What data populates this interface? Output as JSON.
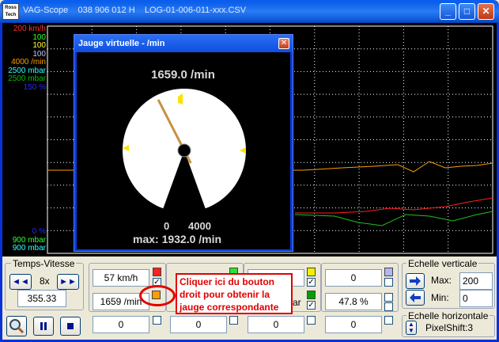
{
  "window": {
    "app_name": "VAG-Scope",
    "title_text": "VAG-Scope    038 906 012 H    LOG-01-006-011-xxx.CSV",
    "logo_text": "Ross Tech"
  },
  "chart": {
    "labels": [
      {
        "text": "200 km/h",
        "color": "#ff3030"
      },
      {
        "text": "100",
        "color": "#30ff30"
      },
      {
        "text": "100",
        "color": "#ffff30"
      },
      {
        "text": "100",
        "color": "#c0c0ff"
      },
      {
        "text": "4000 /min",
        "color": "#ff9c00"
      },
      {
        "text": "2500 mbar",
        "color": "#30ffff"
      },
      {
        "text": "2500 mbar",
        "color": "#00c000"
      },
      {
        "text": "150 %",
        "color": "#2a2aff"
      }
    ],
    "bottom_labels": [
      {
        "text": "0 %",
        "color": "#2a2aff"
      },
      {
        "text": "900 mbar",
        "color": "#30ff30"
      },
      {
        "text": "900 mbar",
        "color": "#30ffff"
      }
    ],
    "series_colors": {
      "speed": "#ff2020",
      "rpm": "#ff9c00",
      "pressure": "#20c020"
    }
  },
  "gauge": {
    "title": "Jauge virtuelle - /min",
    "current_value": "1659.0 /min",
    "range_min": "0",
    "range_max": "4000",
    "max_value": "max: 1932.0 /min",
    "needle_fraction": 0.415
  },
  "panel": {
    "temps_vitesse": {
      "title": "Temps-Vitesse",
      "speed": "8x",
      "time": "355.33",
      "rew": "◄◄",
      "fwd": "►►"
    },
    "fields": {
      "f1": "57 km/h",
      "f2": "1659 /min",
      "f3": "0",
      "f4": "0",
      "f5": "0",
      "f6": "0",
      "f7": "0",
      "f8": "ar",
      "f9": "0",
      "f10": "47.8 %",
      "f11": "0"
    },
    "check_mark": "✓",
    "echelle_verticale": {
      "title": "Echelle verticale",
      "max_label": "Max:",
      "max_value": "200",
      "min_label": "Min:",
      "min_value": "0"
    },
    "echelle_horizontale": {
      "title": "Echelle horizontale",
      "pixelshift": "PixelShift:3"
    }
  },
  "callout": {
    "text": "Cliquer ici du bouton droit pour obtenir la jauge correspondante"
  }
}
